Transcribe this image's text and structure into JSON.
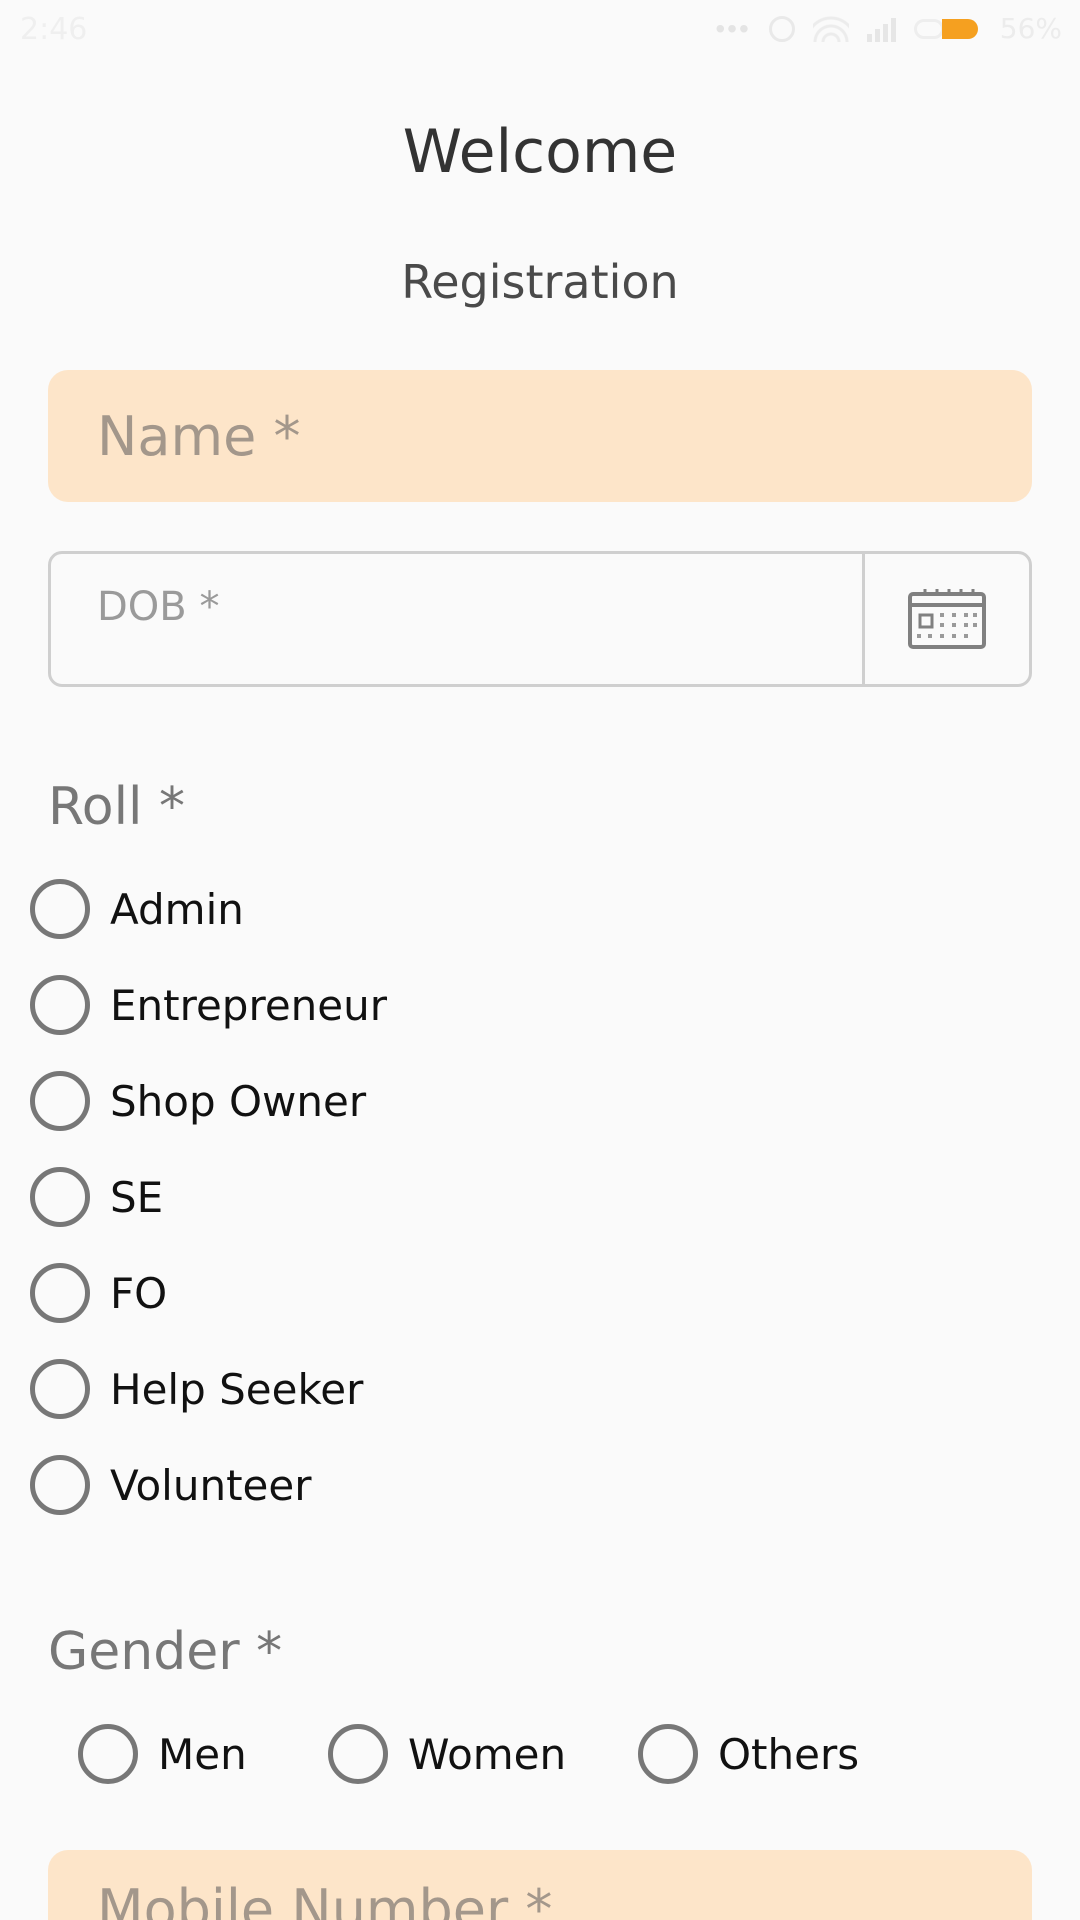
{
  "status_bar": {
    "time": "2:46",
    "dots": "•••",
    "battery_percent": "56%",
    "battery_color": "#f5a020",
    "icons": [
      "alarm-icon",
      "wifi-icon",
      "signal-icon",
      "battery-icon"
    ]
  },
  "header": {
    "title": "Welcome",
    "subtitle": "Registration"
  },
  "form": {
    "name_placeholder": "Name *",
    "dob_placeholder": "DOB *",
    "roll_label": "Roll *",
    "roll_options": [
      "Admin",
      "Entrepreneur",
      "Shop Owner",
      "SE",
      "FO",
      "Help Seeker",
      "Volunteer"
    ],
    "gender_label": "Gender *",
    "gender_options": [
      "Men",
      "Women",
      "Others"
    ],
    "mobile_placeholder": "Mobile Number *"
  },
  "colors": {
    "input_fill": "#fde5c9",
    "radio_border": "#777777"
  }
}
